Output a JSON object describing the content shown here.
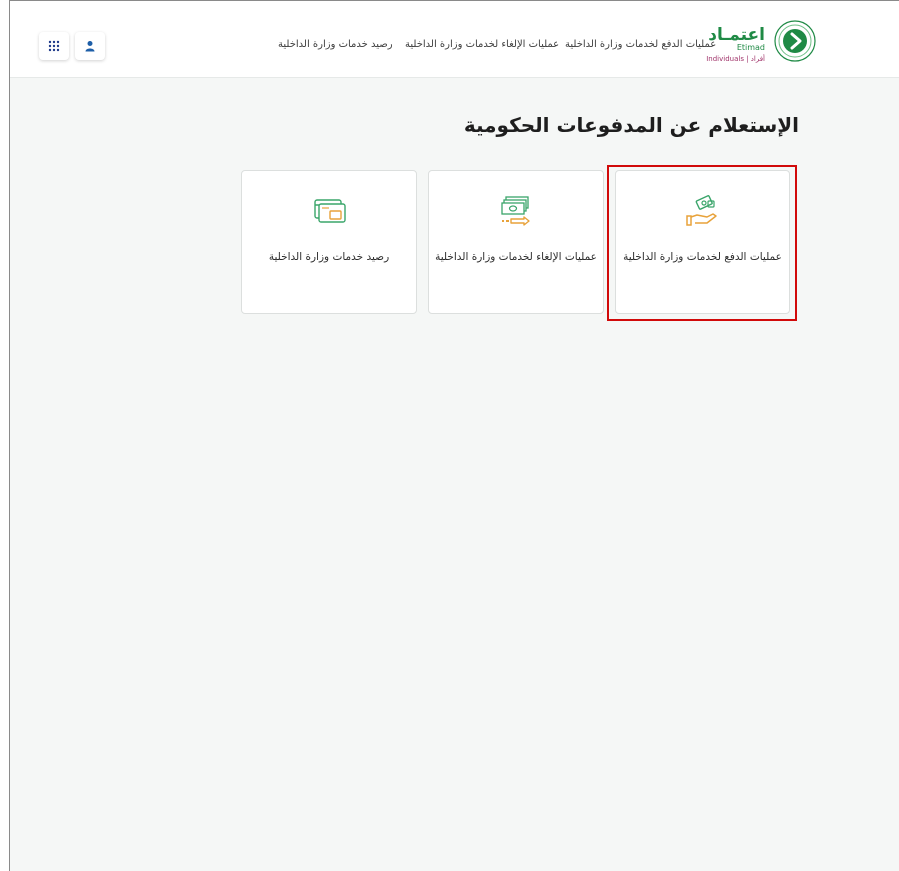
{
  "header": {
    "logo": {
      "name_ar": "اعتمـاد",
      "name_en": "Etimad",
      "sub": "Individuals | أفراد"
    },
    "nav": [
      "عمليات الدفع لخدمات وزارة الداخلية",
      "عمليات الإلغاء لخدمات وزارة الداخلية",
      "رصيد خدمات وزارة الداخلية"
    ],
    "apps_icon": "grid-icon",
    "user_icon": "user-icon"
  },
  "main": {
    "title": "الإستعلام عن المدفوعات الحكومية",
    "cards": [
      {
        "label": "عمليات الدفع لخدمات وزارة الداخلية",
        "icon": "hand-money-icon"
      },
      {
        "label": "عمليات الإلغاء لخدمات وزارة الداخلية",
        "icon": "cash-refund-icon"
      },
      {
        "label": "رصيد خدمات وزارة الداخلية",
        "icon": "card-balance-icon"
      }
    ]
  },
  "colors": {
    "brand_green": "#1f8a45",
    "accent_purple": "#a0336a",
    "highlight_red": "#d10a0a",
    "icon_green": "#3aa56a",
    "icon_orange": "#e8a23a"
  }
}
